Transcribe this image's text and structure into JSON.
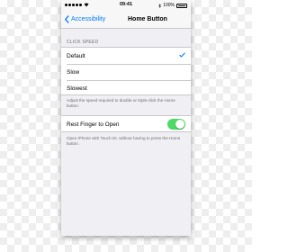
{
  "status_bar": {
    "carrier_icon": "wifi-icon",
    "time": "09:41",
    "battery_percent": "100%",
    "bluetooth_icon": "bluetooth-icon"
  },
  "nav": {
    "back_label": "Accessibility",
    "title": "Home Button"
  },
  "click_speed": {
    "header": "CLICK SPEED",
    "options": [
      {
        "label": "Default",
        "selected": true
      },
      {
        "label": "Slow",
        "selected": false
      },
      {
        "label": "Slowest",
        "selected": false
      }
    ],
    "footer": "Adjust the speed required to double or triple-click the Home button."
  },
  "rest_finger": {
    "label": "Rest Finger to Open",
    "enabled": true,
    "footer": "Open iPhone with Touch ID, without having to press the Home button."
  },
  "colors": {
    "accent": "#007aff",
    "toggle_on": "#4cd964",
    "background": "#efeff4"
  }
}
